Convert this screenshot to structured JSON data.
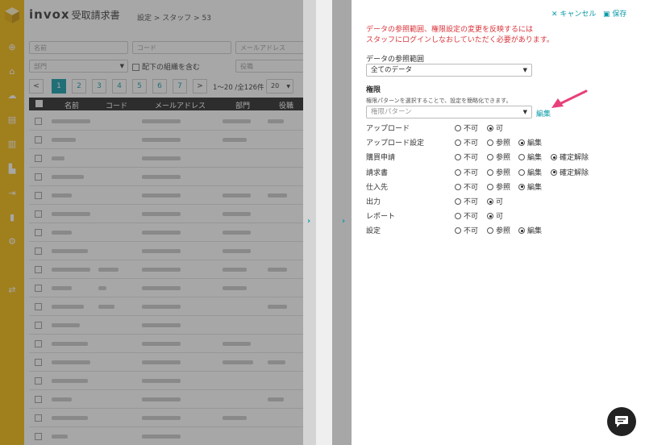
{
  "app": {
    "brand": "invox",
    "brand_sub": "受取請求書"
  },
  "breadcrumb": "設定 > スタッフ > 53",
  "filters": {
    "name_placeholder": "名前",
    "code_placeholder": "コード",
    "email_placeholder": "メールアドレス",
    "dept_placeholder": "部門",
    "include_sub_label": "配下の組織を含む",
    "role_placeholder": "役職"
  },
  "pager": {
    "prev": "<",
    "pages": [
      "1",
      "2",
      "3",
      "4",
      "5",
      "6",
      "7"
    ],
    "next": ">",
    "range": "1〜20 /全126件",
    "per_page": "20"
  },
  "table": {
    "columns": [
      "名前",
      "コード",
      "メールアドレス",
      "部門",
      "役職"
    ]
  },
  "drawer": {
    "cancel_label": "キャンセル",
    "save_label": "保存",
    "notice_line1": "データの参照範囲、権限設定の変更を反映するには",
    "notice_line2": "スタッフにログインしなおしていただく必要があります。",
    "scope_label": "データの参照範囲",
    "scope_value": "全てのデータ",
    "perm_title": "権限",
    "perm_hint": "権限パターンを選択することで、設定を簡略化できます。",
    "pattern_placeholder": "権限パターン",
    "edit_link": "編集",
    "permissions": [
      {
        "name": "アップロード",
        "options": [
          "不可",
          "可"
        ],
        "selected": "可"
      },
      {
        "name": "アップロード設定",
        "options": [
          "不可",
          "参照",
          "編集"
        ],
        "selected": "編集"
      },
      {
        "name": "購買申請",
        "options": [
          "不可",
          "参照",
          "編集",
          "確定解除"
        ],
        "selected": "確定解除"
      },
      {
        "name": "請求書",
        "options": [
          "不可",
          "参照",
          "編集",
          "確定解除"
        ],
        "selected": "確定解除"
      },
      {
        "name": "仕入先",
        "options": [
          "不可",
          "参照",
          "編集"
        ],
        "selected": "編集"
      },
      {
        "name": "出力",
        "options": [
          "不可",
          "可"
        ],
        "selected": "可"
      },
      {
        "name": "レポート",
        "options": [
          "不可",
          "可"
        ],
        "selected": "可"
      },
      {
        "name": "設定",
        "options": [
          "不可",
          "参照",
          "編集"
        ],
        "selected": "編集"
      }
    ]
  },
  "colors": {
    "accent": "#0a9aa8",
    "sidebar": "#f2b705",
    "notice": "#d9333a",
    "arrow": "#e8407a"
  }
}
